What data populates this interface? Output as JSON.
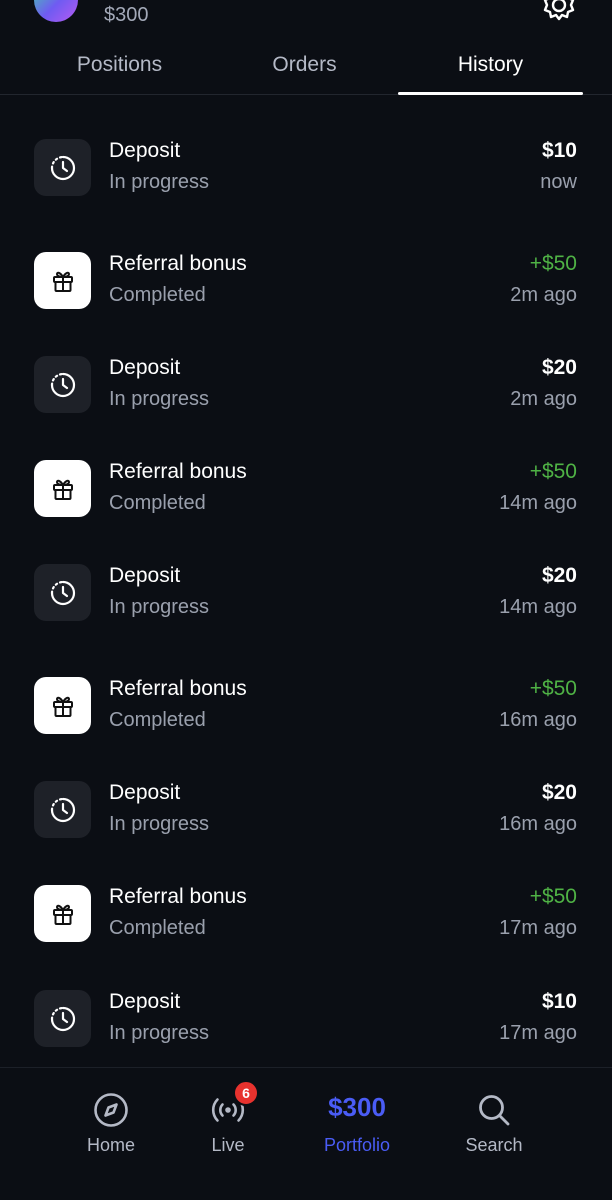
{
  "header": {
    "balance": "$300"
  },
  "tabs": [
    {
      "label": "Positions",
      "active": false
    },
    {
      "label": "Orders",
      "active": false
    },
    {
      "label": "History",
      "active": true
    }
  ],
  "history": [
    {
      "type": "deposit",
      "title": "Deposit",
      "status": "In progress",
      "amount": "$10",
      "time": "now",
      "icon": "clock-icon"
    },
    {
      "type": "bonus",
      "title": "Referral bonus",
      "status": "Completed",
      "amount": "+$50",
      "time": "2m ago",
      "icon": "gift-icon"
    },
    {
      "type": "deposit",
      "title": "Deposit",
      "status": "In progress",
      "amount": "$20",
      "time": "2m ago",
      "icon": "clock-icon"
    },
    {
      "type": "bonus",
      "title": "Referral bonus",
      "status": "Completed",
      "amount": "+$50",
      "time": "14m ago",
      "icon": "gift-icon"
    },
    {
      "type": "deposit",
      "title": "Deposit",
      "status": "In progress",
      "amount": "$20",
      "time": "14m ago",
      "icon": "clock-icon"
    },
    {
      "type": "bonus",
      "title": "Referral bonus",
      "status": "Completed",
      "amount": "+$50",
      "time": "16m ago",
      "icon": "gift-icon"
    },
    {
      "type": "deposit",
      "title": "Deposit",
      "status": "In progress",
      "amount": "$20",
      "time": "16m ago",
      "icon": "clock-icon"
    },
    {
      "type": "bonus",
      "title": "Referral bonus",
      "status": "Completed",
      "amount": "+$50",
      "time": "17m ago",
      "icon": "gift-icon"
    },
    {
      "type": "deposit",
      "title": "Deposit",
      "status": "In progress",
      "amount": "$10",
      "time": "17m ago",
      "icon": "clock-icon"
    }
  ],
  "nav": {
    "home": {
      "label": "Home",
      "icon": "compass-icon"
    },
    "live": {
      "label": "Live",
      "icon": "broadcast-icon",
      "badge": "6"
    },
    "portfolio": {
      "label": "Portfolio",
      "value": "$300"
    },
    "search": {
      "label": "Search",
      "icon": "search-icon"
    }
  },
  "colors": {
    "background": "#0b0e14",
    "accent": "#4a5cf5",
    "positive": "#4fb245",
    "badge": "#e8322e",
    "muted_text": "#9aa0ad"
  }
}
